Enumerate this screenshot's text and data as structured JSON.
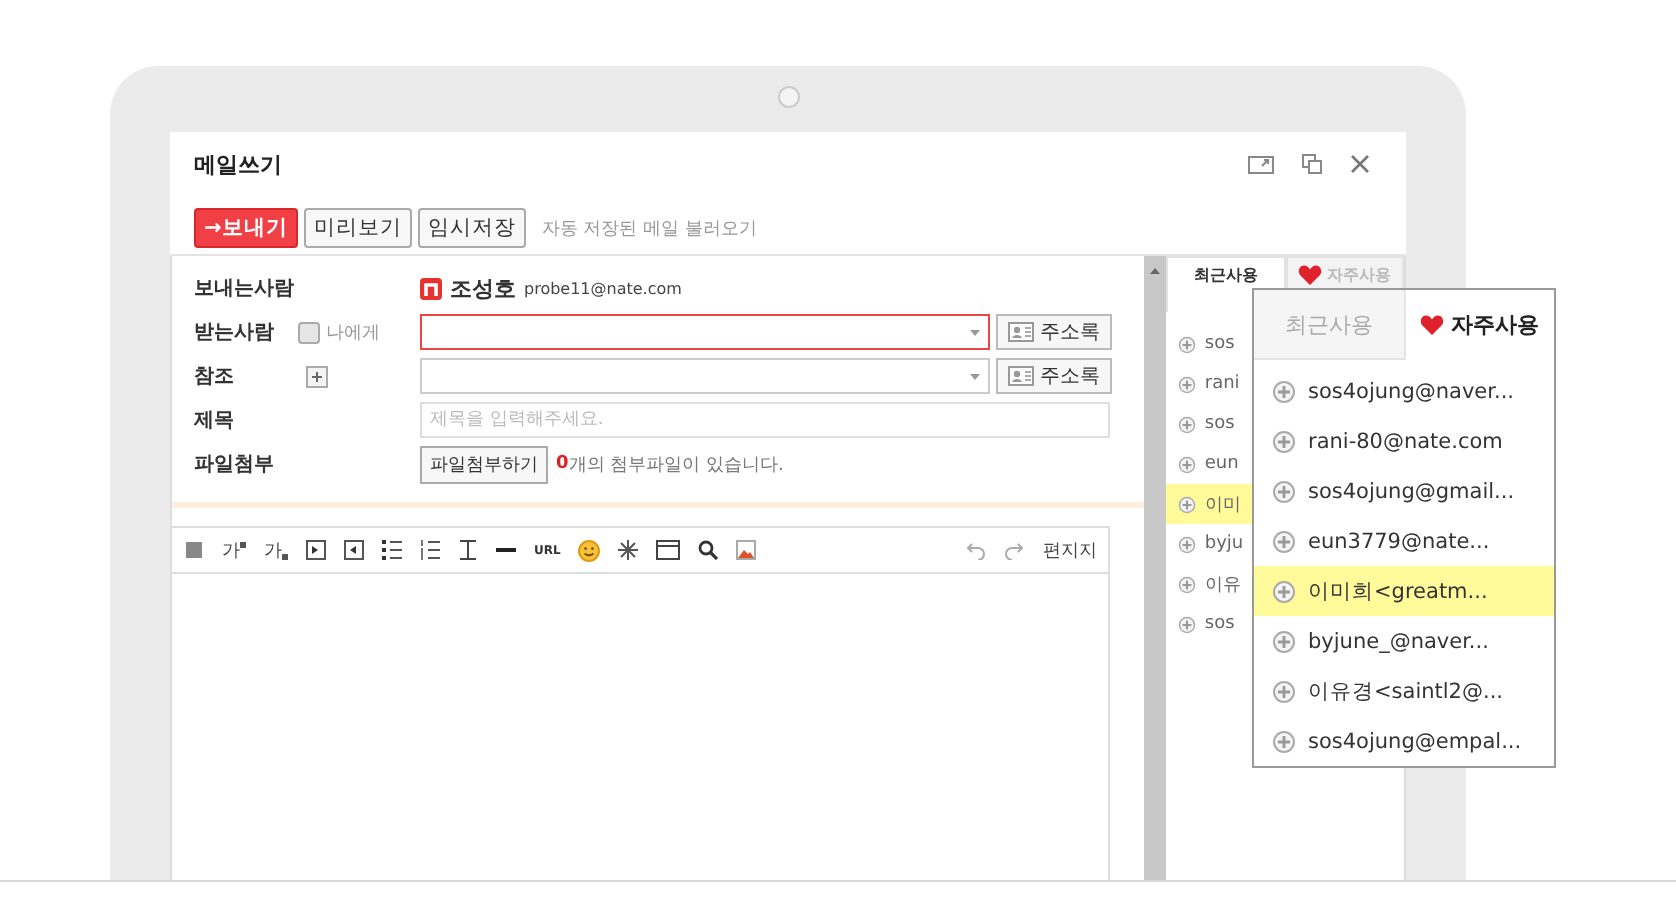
{
  "window": {
    "title": "메일쓰기"
  },
  "actions": [
    {
      "label": "→보내기",
      "kind": "primary"
    },
    {
      "label": "미리보기",
      "kind": "normal"
    },
    {
      "label": "임시저장",
      "kind": "normal"
    }
  ],
  "autosave_link": "자동 저장된 메일 불러오기",
  "sender": {
    "label": "보내는사람",
    "name": "조성호",
    "email": "probe11@nate.com"
  },
  "recipient": {
    "label": "받는사람",
    "to_me": {
      "label": "나에게",
      "checked": false
    },
    "address_book": "주소록"
  },
  "cc": {
    "label": "참조",
    "address_book": "주소록"
  },
  "subject": {
    "label": "제목",
    "placeholder": "제목을 입력해주세요."
  },
  "attachment": {
    "label": "파일첨부",
    "button": "파일첨부하기",
    "count": "0",
    "note": "개의 첨부파일이 있습니다."
  },
  "editor": {
    "superscript": "가",
    "subscript": "가",
    "url": "URL",
    "stationery": "편지지"
  },
  "side_panel": {
    "tabs": [
      {
        "label": "최근사용",
        "selected": true
      },
      {
        "label": "자주사용",
        "selected": false
      }
    ],
    "items": [
      {
        "text": "sos",
        "selected": false
      },
      {
        "text": "rani",
        "selected": false
      },
      {
        "text": "sos",
        "selected": false
      },
      {
        "text": "eun",
        "selected": false
      },
      {
        "text": "이미",
        "selected": true
      },
      {
        "text": "byju",
        "selected": false
      },
      {
        "text": "이유",
        "selected": false
      },
      {
        "text": "sos",
        "selected": false
      }
    ]
  },
  "popup": {
    "tabs": [
      {
        "label": "최근사용",
        "selected": false
      },
      {
        "label": "자주사용",
        "selected": true
      }
    ],
    "items": [
      {
        "text": "sos4ojung@naver...",
        "selected": false
      },
      {
        "text": "rani-80@nate.com",
        "selected": false
      },
      {
        "text": "sos4ojung@gmail...",
        "selected": false
      },
      {
        "text": "eun3779@nate...",
        "selected": false
      },
      {
        "text": "이미희<greatm...",
        "selected": true
      },
      {
        "text": "byjune_@naver...",
        "selected": false
      },
      {
        "text": "이유경<saintl2@...",
        "selected": false
      },
      {
        "text": "sos4ojung@empal...",
        "selected": false
      }
    ]
  }
}
